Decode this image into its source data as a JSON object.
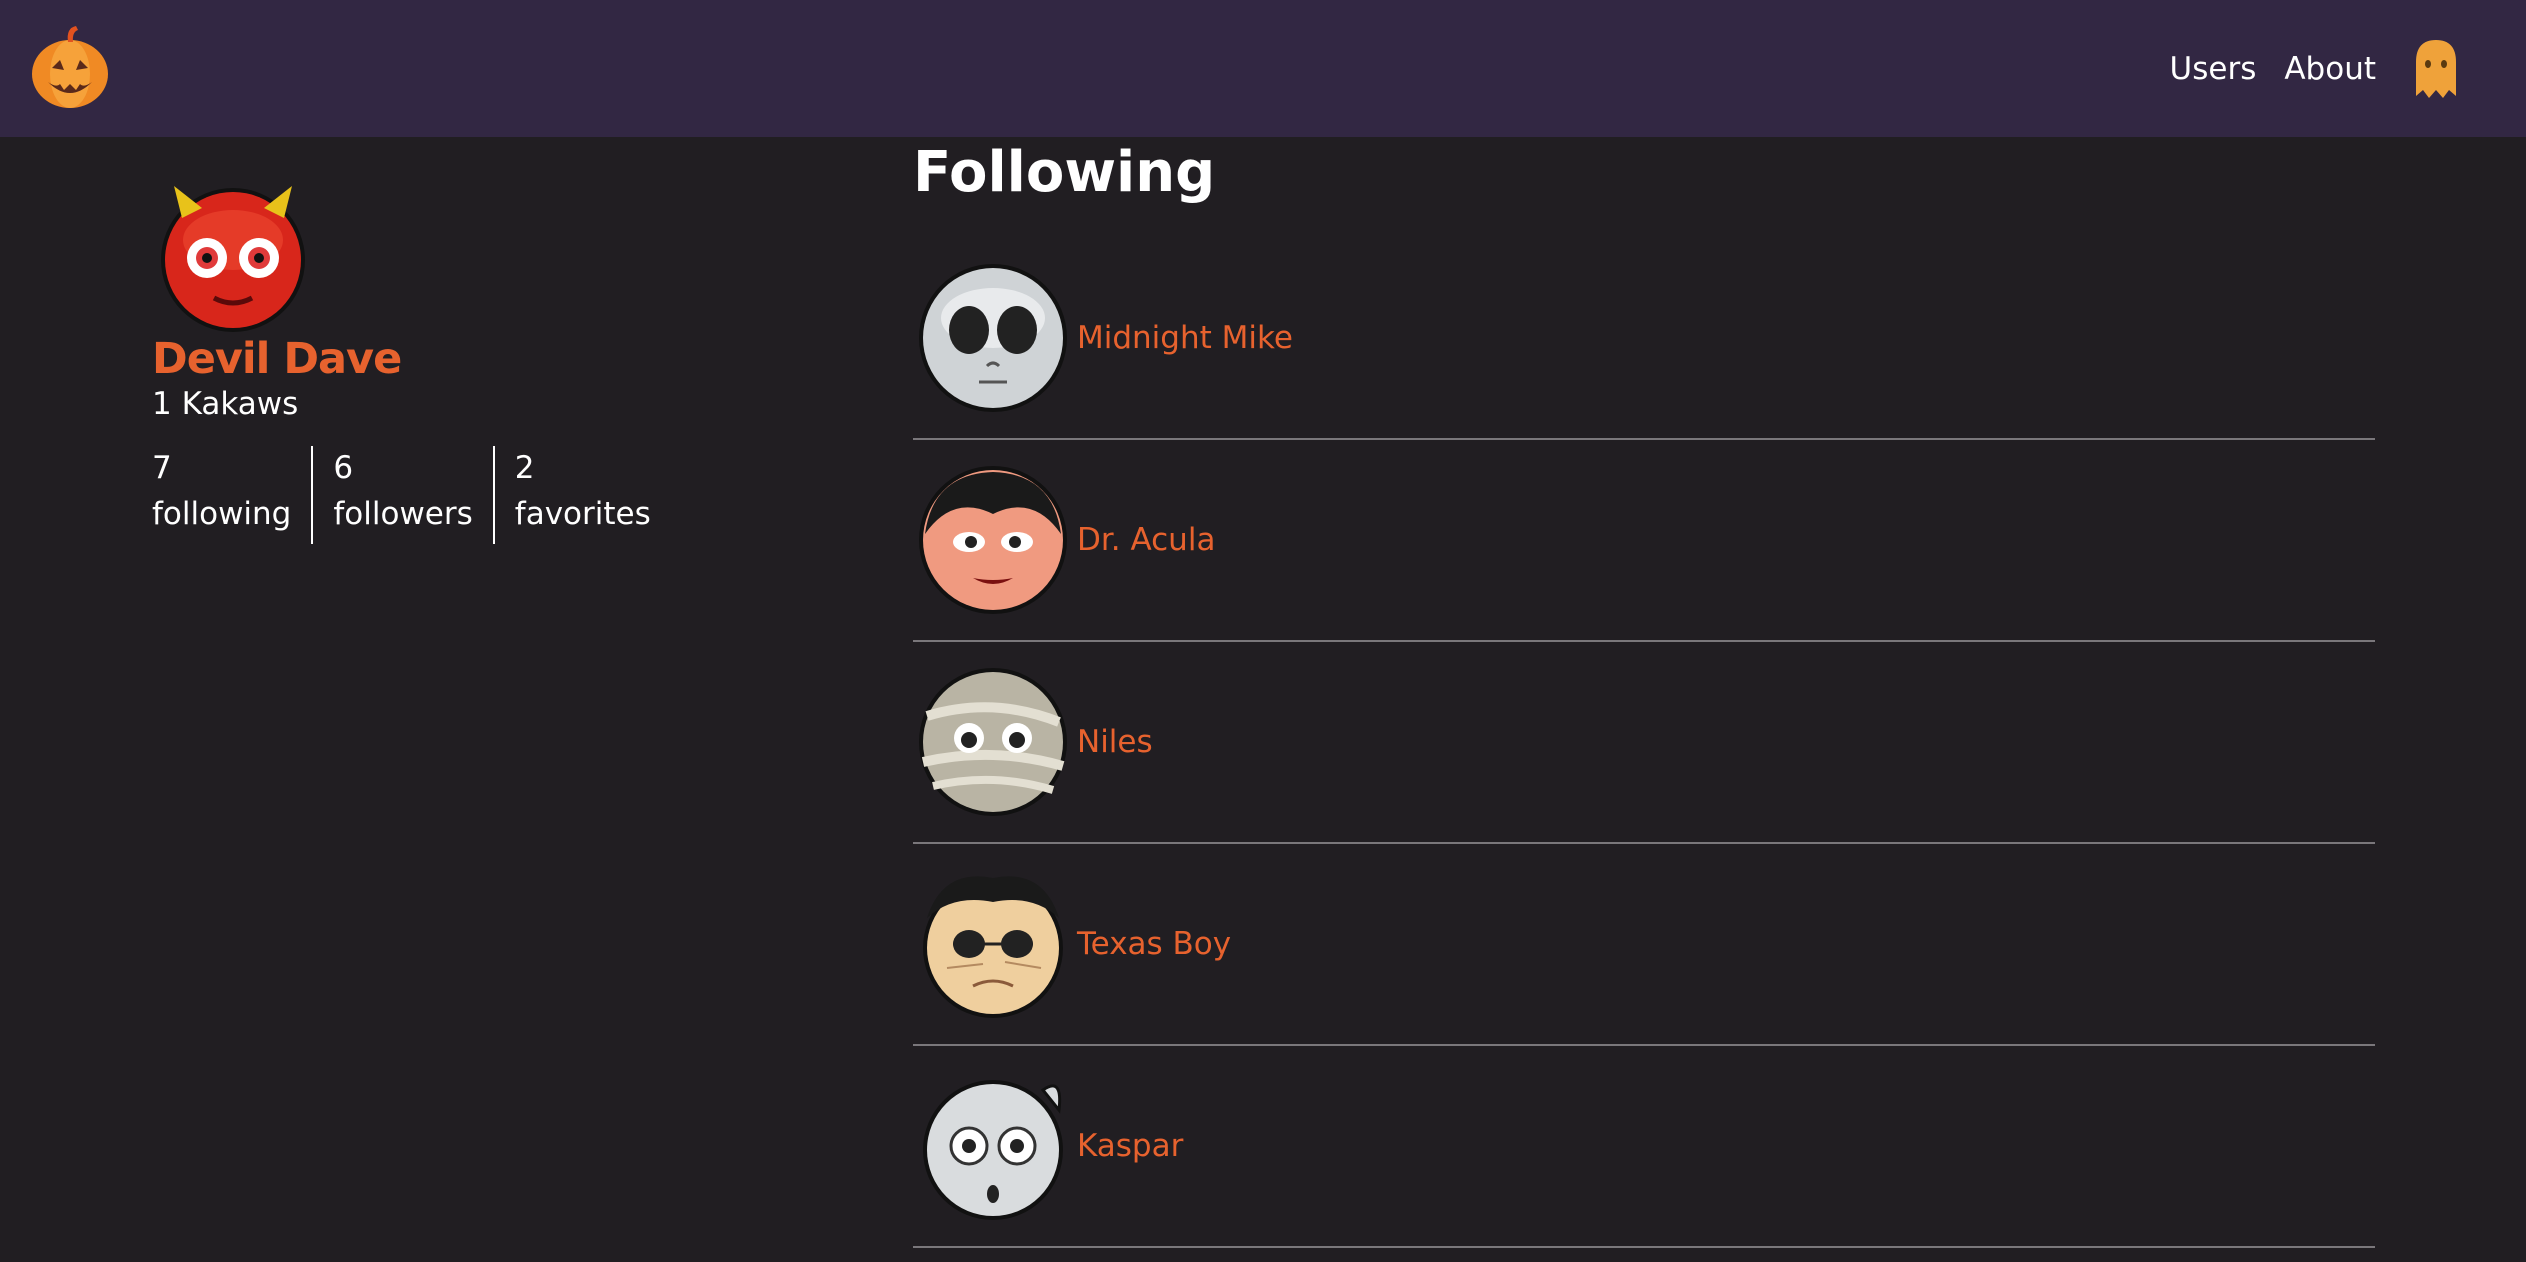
{
  "nav": {
    "links": [
      "Users",
      "About"
    ]
  },
  "profile": {
    "name": "Devil Dave",
    "kakaws": "1 Kakaws",
    "stats": [
      {
        "count": "7",
        "label": "following"
      },
      {
        "count": "6",
        "label": "followers"
      },
      {
        "count": "2",
        "label": "favorites"
      }
    ]
  },
  "main": {
    "heading": "Following",
    "users": [
      {
        "name": "Midnight Mike",
        "avatar": "skull-face-icon"
      },
      {
        "name": "Dr. Acula",
        "avatar": "vampire-face-icon"
      },
      {
        "name": "Niles",
        "avatar": "mummy-face-icon"
      },
      {
        "name": "Texas Boy",
        "avatar": "leatherface-icon"
      },
      {
        "name": "Kaspar",
        "avatar": "ghost-face-icon"
      }
    ]
  },
  "colors": {
    "navbar": "#322743",
    "background": "#211e22",
    "accent": "#e7622e",
    "divider": "#7a777b"
  }
}
